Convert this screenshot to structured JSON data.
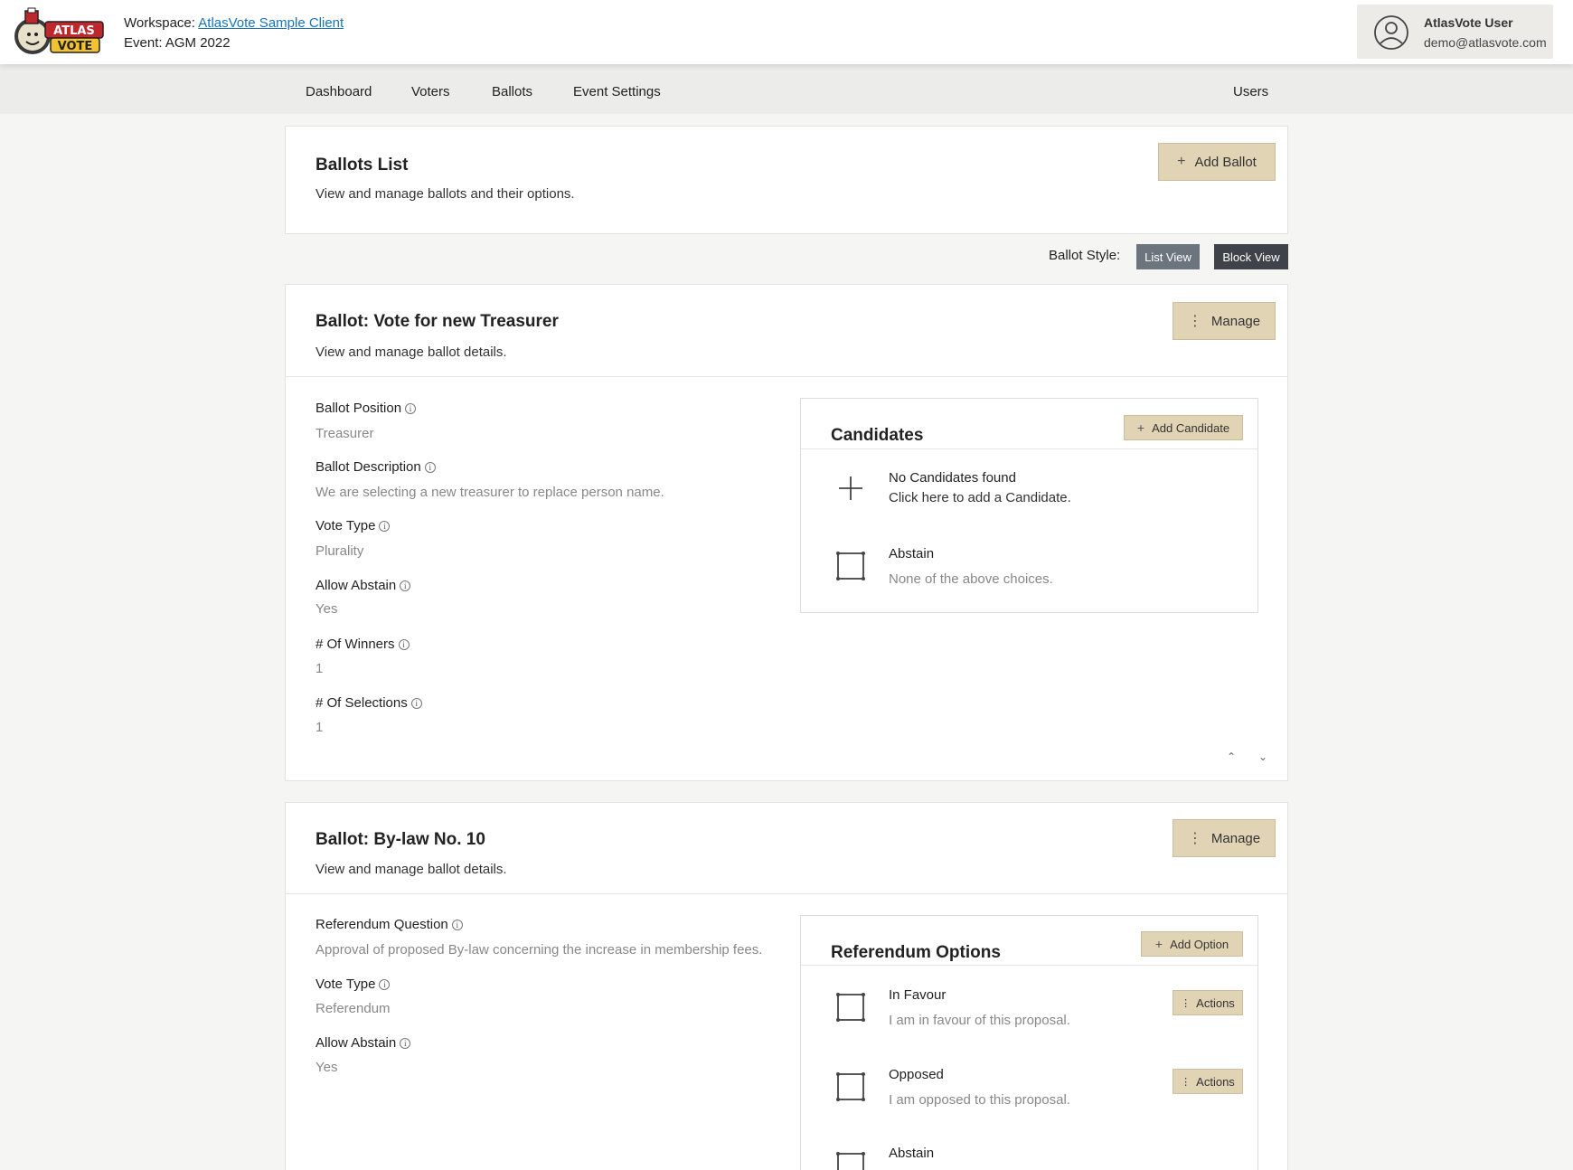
{
  "header": {
    "logo_text": "ATLAS VOTE",
    "workspace_label": "Workspace:",
    "workspace_name": "AtlasVote Sample Client",
    "event_text": "Event: AGM 2022",
    "user_name": "AtlasVote User",
    "user_email": "demo@atlasvote.com"
  },
  "nav": {
    "dashboard": "Dashboard",
    "voters": "Voters",
    "ballots": "Ballots",
    "event_settings": "Event Settings",
    "users": "Users"
  },
  "ballots_list": {
    "title": "Ballots List",
    "subtitle": "View and manage ballots and their options.",
    "add_button": "Add Ballot"
  },
  "ballot_style": {
    "label": "Ballot Style:",
    "list_view": "List View",
    "block_view": "Block View"
  },
  "ballot1": {
    "title": "Ballot: Vote for new Treasurer",
    "subtitle": "View and manage ballot details.",
    "manage_button": "Manage",
    "fields": {
      "position_label": "Ballot Position",
      "position_value": "Treasurer",
      "description_label": "Ballot Description",
      "description_value": "We are selecting a new treasurer to replace person name.",
      "vote_type_label": "Vote Type",
      "vote_type_value": "Plurality",
      "allow_abstain_label": "Allow Abstain",
      "allow_abstain_value": "Yes",
      "winners_label": "# Of Winners",
      "winners_value": "1",
      "selections_label": "# Of Selections",
      "selections_value": "1"
    },
    "candidates": {
      "title": "Candidates",
      "add_button": "Add Candidate",
      "empty_title": "No Candidates found",
      "empty_sub": "Click here to add a Candidate.",
      "abstain_title": "Abstain",
      "abstain_sub": "None of the above choices."
    }
  },
  "ballot2": {
    "title": "Ballot: By-law No. 10",
    "subtitle": "View and manage ballot details.",
    "manage_button": "Manage",
    "fields": {
      "question_label": "Referendum Question",
      "question_value": "Approval of proposed By-law concerning the increase in membership fees.",
      "vote_type_label": "Vote Type",
      "vote_type_value": "Referendum",
      "allow_abstain_label": "Allow Abstain",
      "allow_abstain_value": "Yes"
    },
    "options": {
      "title": "Referendum Options",
      "add_button": "Add Option",
      "items": [
        {
          "title": "In Favour",
          "sub": "I am in favour of this proposal.",
          "action": "Actions"
        },
        {
          "title": "Opposed",
          "sub": "I am opposed to this proposal.",
          "action": "Actions"
        },
        {
          "title": "Abstain"
        }
      ]
    }
  },
  "colors": {
    "button_tan": "#e1d4b5",
    "list_view_bg": "#6c757d",
    "block_view_bg": "#3f4349",
    "link": "#1a73b8"
  }
}
